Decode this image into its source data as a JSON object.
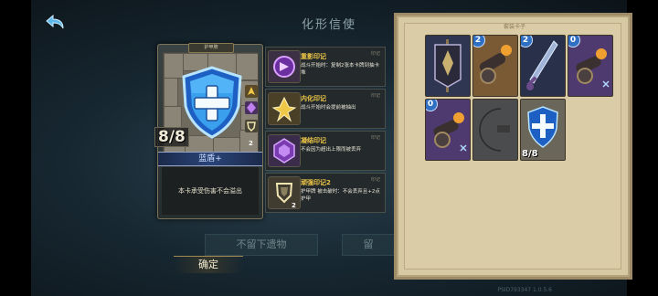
{
  "header": {
    "title": "化形信使"
  },
  "detail_card": {
    "type_label": "护甲牌",
    "stat": "8/8",
    "name": "蓝盾+",
    "description": "本卡承受伤害不会溢出",
    "side_badge": "2"
  },
  "marks": [
    {
      "name": "重影印记",
      "tag": "印记",
      "desc": "战斗开始时：复制2张本卡牌到抽卡堆",
      "num": ""
    },
    {
      "name": "内化印记",
      "tag": "印记",
      "desc": "战斗开始时会提前被抽出",
      "num": ""
    },
    {
      "name": "凝结印记",
      "tag": "印记",
      "desc": "不会因为超出上限而被丢弃",
      "num": ""
    },
    {
      "name": "顽强印记2",
      "tag": "印记",
      "desc": "护甲牌 被击破时：不会丢弃且+2点护甲",
      "num": "2"
    }
  ],
  "buttons": {
    "no_leave": "不留下遗物",
    "leave": "留",
    "confirm": "确定"
  },
  "panel": {
    "header_fragment": "套装卡子",
    "cards": [
      {
        "name": "banner-card",
        "cost": ""
      },
      {
        "name": "cannon-card",
        "cost": "2"
      },
      {
        "name": "sword-card",
        "cost": "2"
      },
      {
        "name": "cannon-card-2",
        "cost": "0"
      },
      {
        "name": "cannon-card-3",
        "cost": "0"
      },
      {
        "name": "crescent-card",
        "cost": ""
      },
      {
        "name": "blue-shield-card",
        "cost": "",
        "stat": "8/8"
      }
    ]
  },
  "version": "PSID793347 1.0.5.6"
}
